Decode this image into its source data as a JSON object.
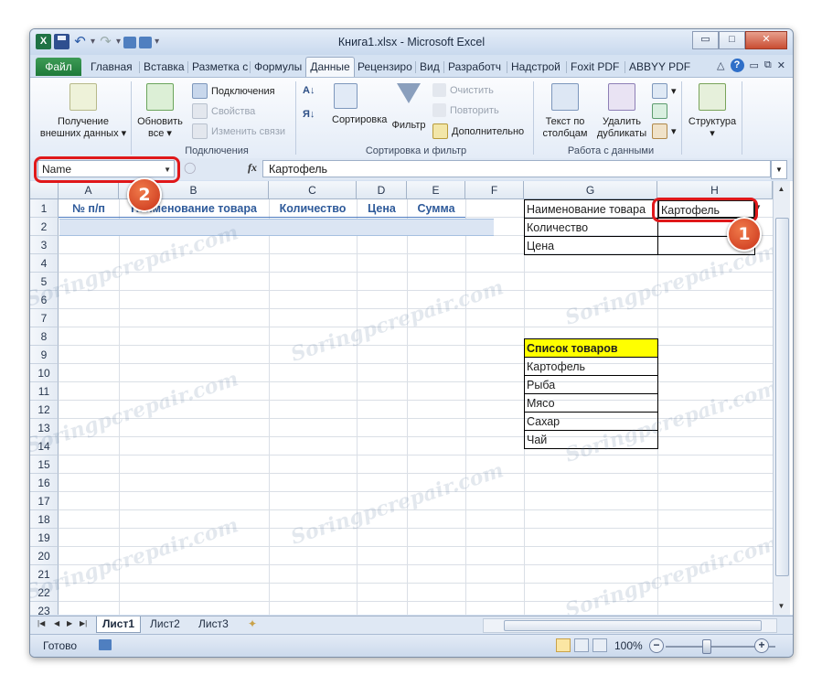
{
  "window": {
    "title": "Книга1.xlsx - Microsoft Excel",
    "controls": {
      "minimize": "▭",
      "maximize": "□",
      "close": "✕"
    }
  },
  "qat": {
    "logo": "X",
    "dropdown": "▾"
  },
  "ribbon_tabs": {
    "file": "Файл",
    "items": [
      "Главная",
      "Вставка",
      "Разметка с",
      "Формулы",
      "Данные",
      "Рецензиро",
      "Вид",
      "Разработч",
      "Надстрой",
      "Foxit PDF",
      "ABBYY PDF"
    ],
    "active": "Данные",
    "help": "?"
  },
  "ribbon": {
    "get_external": "Получение внешних данных",
    "refresh_all": "Обновить все",
    "connections": "Подключения",
    "properties": "Свойства",
    "edit_links": "Изменить связи",
    "connections_group": "Подключения",
    "sort": "Сортировка",
    "filter": "Фильтр",
    "clear": "Очистить",
    "reapply": "Повторить",
    "advanced": "Дополнительно",
    "sort_filter_group": "Сортировка и фильтр",
    "text_to_columns": "Текст по столбцам",
    "remove_duplicates": "Удалить дубликаты",
    "data_tools_group": "Работа с данными",
    "outline": "Структура"
  },
  "formula_bar": {
    "name_box": "Name",
    "fx": "fx",
    "value": "Картофель"
  },
  "columns": [
    "A",
    "B",
    "C",
    "D",
    "E",
    "F",
    "G",
    "H"
  ],
  "rows": [
    "1",
    "2",
    "3",
    "4",
    "5",
    "6",
    "7",
    "8",
    "9",
    "10",
    "11",
    "12",
    "13",
    "14",
    "15",
    "16",
    "17",
    "18",
    "19",
    "20",
    "21",
    "22",
    "23"
  ],
  "table_headers": [
    "№ п/п",
    "Наименование товара",
    "Количество",
    "Цена",
    "Сумма"
  ],
  "lookup": {
    "labels": [
      "Наименование товара",
      "Количество",
      "Цена"
    ],
    "selected_value": "Картофель"
  },
  "product_list": {
    "title": "Список товаров",
    "items": [
      "Картофель",
      "Рыба",
      "Мясо",
      "Сахар",
      "Чай"
    ]
  },
  "sheets": {
    "tabs": [
      "Лист1",
      "Лист2",
      "Лист3"
    ],
    "active": "Лист1"
  },
  "status": {
    "ready": "Готово",
    "zoom": "100%"
  },
  "callouts": {
    "one": "1",
    "two": "2"
  },
  "watermark": "Soringpcrepair.com",
  "colors": {
    "file_tab": "#1f7a3a",
    "yellow_fill": "#ffff00",
    "callout_red": "#e0181a",
    "header_blue": "#2e5a9a"
  }
}
